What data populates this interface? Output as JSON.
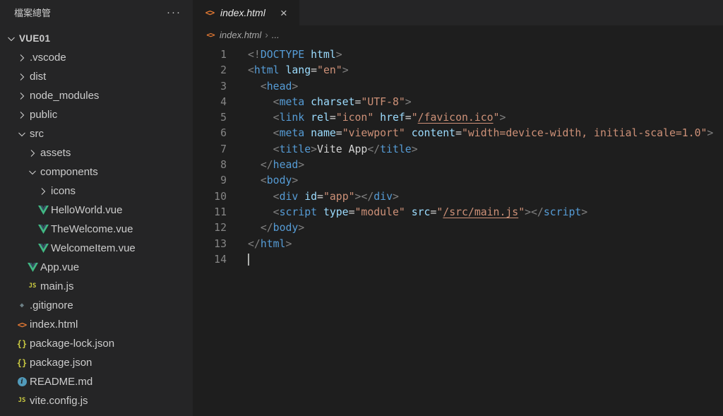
{
  "sidebar": {
    "title": "檔案總管",
    "menu_label": "···",
    "tree": [
      {
        "label": "VUE01",
        "indent": 0,
        "type": "folder",
        "state": "expanded",
        "root": true
      },
      {
        "label": ".vscode",
        "indent": 1,
        "type": "folder",
        "state": "collapsed"
      },
      {
        "label": "dist",
        "indent": 1,
        "type": "folder",
        "state": "collapsed"
      },
      {
        "label": "node_modules",
        "indent": 1,
        "type": "folder",
        "state": "collapsed"
      },
      {
        "label": "public",
        "indent": 1,
        "type": "folder",
        "state": "collapsed"
      },
      {
        "label": "src",
        "indent": 1,
        "type": "folder",
        "state": "expanded"
      },
      {
        "label": "assets",
        "indent": 2,
        "type": "folder",
        "state": "collapsed"
      },
      {
        "label": "components",
        "indent": 2,
        "type": "folder",
        "state": "expanded"
      },
      {
        "label": "icons",
        "indent": 3,
        "type": "folder",
        "state": "collapsed"
      },
      {
        "label": "HelloWorld.vue",
        "indent": 3,
        "type": "file",
        "icon": "vue-icon"
      },
      {
        "label": "TheWelcome.vue",
        "indent": 3,
        "type": "file",
        "icon": "vue-icon"
      },
      {
        "label": "WelcomeItem.vue",
        "indent": 3,
        "type": "file",
        "icon": "vue-icon"
      },
      {
        "label": "App.vue",
        "indent": 2,
        "type": "file",
        "icon": "vue-icon"
      },
      {
        "label": "main.js",
        "indent": 2,
        "type": "file",
        "icon": "js-icon"
      },
      {
        "label": ".gitignore",
        "indent": 1,
        "type": "file",
        "icon": "git-icon"
      },
      {
        "label": "index.html",
        "indent": 1,
        "type": "file",
        "icon": "html-icon"
      },
      {
        "label": "package-lock.json",
        "indent": 1,
        "type": "file",
        "icon": "json-icon"
      },
      {
        "label": "package.json",
        "indent": 1,
        "type": "file",
        "icon": "json-icon"
      },
      {
        "label": "README.md",
        "indent": 1,
        "type": "file",
        "icon": "info-icon"
      },
      {
        "label": "vite.config.js",
        "indent": 1,
        "type": "file",
        "icon": "js-icon"
      }
    ]
  },
  "editor": {
    "tab": {
      "icon": "html-icon",
      "label": "index.html",
      "close_label": "×"
    },
    "breadcrumb": {
      "icon": "html-icon",
      "file": "index.html",
      "separator": "›",
      "collapsed": "..."
    },
    "cursor_line": 14,
    "code_lines": [
      {
        "num": 1,
        "tokens": [
          {
            "t": "punct",
            "s": "<!"
          },
          {
            "t": "tag",
            "s": "DOCTYPE"
          },
          {
            "t": "attr",
            "s": " html"
          },
          {
            "t": "punct",
            "s": ">"
          }
        ]
      },
      {
        "num": 2,
        "tokens": [
          {
            "t": "punct",
            "s": "<"
          },
          {
            "t": "tag",
            "s": "html"
          },
          {
            "t": "plain",
            "s": " "
          },
          {
            "t": "attr",
            "s": "lang"
          },
          {
            "t": "eq",
            "s": "="
          },
          {
            "t": "str",
            "s": "\"en\""
          },
          {
            "t": "punct",
            "s": ">"
          }
        ]
      },
      {
        "num": 3,
        "tokens": [
          {
            "t": "plain",
            "s": "  "
          },
          {
            "t": "punct",
            "s": "<"
          },
          {
            "t": "tag",
            "s": "head"
          },
          {
            "t": "punct",
            "s": ">"
          }
        ]
      },
      {
        "num": 4,
        "tokens": [
          {
            "t": "plain",
            "s": "    "
          },
          {
            "t": "punct",
            "s": "<"
          },
          {
            "t": "tag",
            "s": "meta"
          },
          {
            "t": "plain",
            "s": " "
          },
          {
            "t": "attr",
            "s": "charset"
          },
          {
            "t": "eq",
            "s": "="
          },
          {
            "t": "str",
            "s": "\"UTF-8\""
          },
          {
            "t": "punct",
            "s": ">"
          }
        ]
      },
      {
        "num": 5,
        "tokens": [
          {
            "t": "plain",
            "s": "    "
          },
          {
            "t": "punct",
            "s": "<"
          },
          {
            "t": "tag",
            "s": "link"
          },
          {
            "t": "plain",
            "s": " "
          },
          {
            "t": "attr",
            "s": "rel"
          },
          {
            "t": "eq",
            "s": "="
          },
          {
            "t": "str",
            "s": "\"icon\""
          },
          {
            "t": "plain",
            "s": " "
          },
          {
            "t": "attr",
            "s": "href"
          },
          {
            "t": "eq",
            "s": "="
          },
          {
            "t": "str",
            "s": "\""
          },
          {
            "t": "link",
            "s": "/favicon.ico"
          },
          {
            "t": "str",
            "s": "\""
          },
          {
            "t": "punct",
            "s": ">"
          }
        ]
      },
      {
        "num": 6,
        "tokens": [
          {
            "t": "plain",
            "s": "    "
          },
          {
            "t": "punct",
            "s": "<"
          },
          {
            "t": "tag",
            "s": "meta"
          },
          {
            "t": "plain",
            "s": " "
          },
          {
            "t": "attr",
            "s": "name"
          },
          {
            "t": "eq",
            "s": "="
          },
          {
            "t": "str",
            "s": "\"viewport\""
          },
          {
            "t": "plain",
            "s": " "
          },
          {
            "t": "attr",
            "s": "content"
          },
          {
            "t": "eq",
            "s": "="
          },
          {
            "t": "str",
            "s": "\"width=device-width, initial-scale=1.0\""
          },
          {
            "t": "punct",
            "s": ">"
          }
        ]
      },
      {
        "num": 7,
        "tokens": [
          {
            "t": "plain",
            "s": "    "
          },
          {
            "t": "punct",
            "s": "<"
          },
          {
            "t": "tag",
            "s": "title"
          },
          {
            "t": "punct",
            "s": ">"
          },
          {
            "t": "text",
            "s": "Vite App"
          },
          {
            "t": "punct",
            "s": "</"
          },
          {
            "t": "tag",
            "s": "title"
          },
          {
            "t": "punct",
            "s": ">"
          }
        ]
      },
      {
        "num": 8,
        "tokens": [
          {
            "t": "plain",
            "s": "  "
          },
          {
            "t": "punct",
            "s": "</"
          },
          {
            "t": "tag",
            "s": "head"
          },
          {
            "t": "punct",
            "s": ">"
          }
        ]
      },
      {
        "num": 9,
        "tokens": [
          {
            "t": "plain",
            "s": "  "
          },
          {
            "t": "punct",
            "s": "<"
          },
          {
            "t": "tag",
            "s": "body"
          },
          {
            "t": "punct",
            "s": ">"
          }
        ]
      },
      {
        "num": 10,
        "tokens": [
          {
            "t": "plain",
            "s": "    "
          },
          {
            "t": "punct",
            "s": "<"
          },
          {
            "t": "tag",
            "s": "div"
          },
          {
            "t": "plain",
            "s": " "
          },
          {
            "t": "attr",
            "s": "id"
          },
          {
            "t": "eq",
            "s": "="
          },
          {
            "t": "str",
            "s": "\"app\""
          },
          {
            "t": "punct",
            "s": "></"
          },
          {
            "t": "tag",
            "s": "div"
          },
          {
            "t": "punct",
            "s": ">"
          }
        ]
      },
      {
        "num": 11,
        "tokens": [
          {
            "t": "plain",
            "s": "    "
          },
          {
            "t": "punct",
            "s": "<"
          },
          {
            "t": "tag",
            "s": "script"
          },
          {
            "t": "plain",
            "s": " "
          },
          {
            "t": "attr",
            "s": "type"
          },
          {
            "t": "eq",
            "s": "="
          },
          {
            "t": "str",
            "s": "\"module\""
          },
          {
            "t": "plain",
            "s": " "
          },
          {
            "t": "attr",
            "s": "src"
          },
          {
            "t": "eq",
            "s": "="
          },
          {
            "t": "str",
            "s": "\""
          },
          {
            "t": "link",
            "s": "/src/main.js"
          },
          {
            "t": "str",
            "s": "\""
          },
          {
            "t": "punct",
            "s": "></"
          },
          {
            "t": "tag",
            "s": "script"
          },
          {
            "t": "punct",
            "s": ">"
          }
        ]
      },
      {
        "num": 12,
        "tokens": [
          {
            "t": "plain",
            "s": "  "
          },
          {
            "t": "punct",
            "s": "</"
          },
          {
            "t": "tag",
            "s": "body"
          },
          {
            "t": "punct",
            "s": ">"
          }
        ]
      },
      {
        "num": 13,
        "tokens": [
          {
            "t": "punct",
            "s": "</"
          },
          {
            "t": "tag",
            "s": "html"
          },
          {
            "t": "punct",
            "s": ">"
          }
        ]
      },
      {
        "num": 14,
        "tokens": []
      }
    ]
  },
  "theme": {
    "editor_bg": "#1e1e1e",
    "sidebar_bg": "#252526",
    "tabbar_bg": "#252526",
    "active_tab_bg": "#1e1e1e",
    "tree_text": "#cccccc",
    "line_number": "#858585",
    "tag_color": "#569cd6",
    "attr_color": "#9cdcfe",
    "string_color": "#ce9178",
    "punct_color": "#808080",
    "plain_text_color": "#d4d4d4",
    "vue_green": "#41b883",
    "js_yellow": "#cbcb41",
    "html_orange": "#e37933",
    "info_blue": "#519aba",
    "git_gray": "#6d8086"
  }
}
